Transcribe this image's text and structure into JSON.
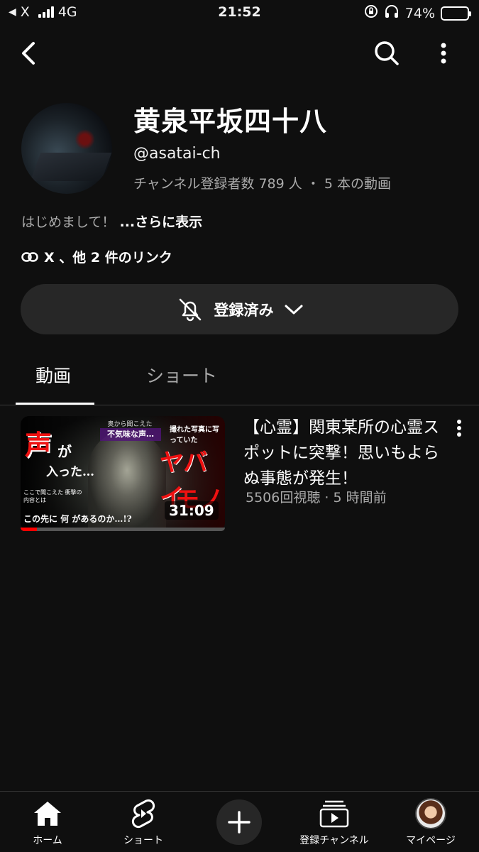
{
  "status_bar": {
    "back_app": "X",
    "network": "4G",
    "time": "21:52",
    "battery_percent": "74%",
    "battery_level": 0.74
  },
  "channel": {
    "name": "黄泉平坂四十八",
    "handle": "@asatai-ch",
    "meta": "チャンネル登録者数 789 人 ・ 5 本の動画",
    "description": "はじめまして！",
    "more_label": "...さらに表示",
    "links_label": "X 、他 2 件のリンク"
  },
  "subscribe": {
    "label": "登録済み"
  },
  "tabs": [
    {
      "label": "動画",
      "active": true
    },
    {
      "label": "ショート",
      "active": false
    }
  ],
  "videos": [
    {
      "title": "【心霊】関東某所の心霊スポットに突撃！思いもよらぬ事態が発生！",
      "meta": "5506回視聴 · 5 時間前",
      "duration": "31:09",
      "watched_fraction": 0.08,
      "thumbnail_text": {
        "t1": "声",
        "t2": "が",
        "t3": "入った…",
        "t4": "奥から聞こえた",
        "t5": "不気味な声…",
        "t6": "撮れた写真に写っていた",
        "t7": "ヤバイ",
        "t8": "モノ",
        "t9": "この先に 何 があるのか…!?",
        "t10": "ここで聞こえた 衝撃の内容とは"
      }
    }
  ],
  "bottom_nav": [
    {
      "label": "ホーム",
      "icon": "home-icon"
    },
    {
      "label": "ショート",
      "icon": "shorts-icon"
    },
    {
      "label": "",
      "icon": "create-icon"
    },
    {
      "label": "登録チャンネル",
      "icon": "subscriptions-icon"
    },
    {
      "label": "マイページ",
      "icon": "avatar"
    }
  ],
  "colors": {
    "background": "#0f0f0f",
    "accent": "#ff0000",
    "secondary_text": "#aaaaaa",
    "pill": "#272727"
  }
}
